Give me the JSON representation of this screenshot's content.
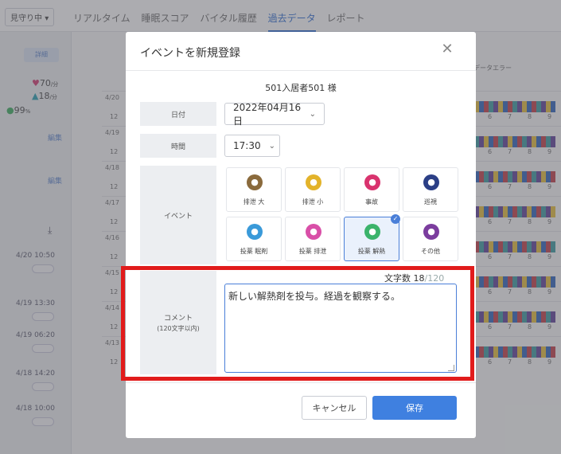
{
  "nav": {
    "watch_label": "見守り中",
    "tabs": [
      {
        "label": "リアルタイム"
      },
      {
        "label": "睡眠スコア"
      },
      {
        "label": "バイタル履歴"
      },
      {
        "label": "過去データ"
      },
      {
        "label": "レポート"
      }
    ],
    "active_tab": "過去データ"
  },
  "sidebar": {
    "detail_button": "詳細",
    "heart_rate": "70",
    "heart_unit": "/分",
    "breath_rate": "18",
    "breath_unit": "/分",
    "spo2": "99",
    "spo2_unit": "%",
    "edit_label_1": "編集",
    "edit_label_2": "編集",
    "entries": [
      {
        "time": "4/20 10:50"
      },
      {
        "time": "4/19 13:30"
      },
      {
        "time": "4/19 06:20"
      },
      {
        "time": "4/18 14:20"
      },
      {
        "time": "4/18 10:00"
      }
    ]
  },
  "chart": {
    "dates": [
      "4/20",
      "4/19",
      "4/18",
      "4/17",
      "4/16",
      "4/15",
      "4/14",
      "4/13"
    ],
    "hour_ticks": [
      "5",
      "6",
      "7",
      "8",
      "9"
    ],
    "row_start_tick": "12",
    "data_error_label": "データエラー",
    "colors": {
      "purple": "#6b4fa0",
      "yellow": "#e8c34a",
      "blue": "#3d6fc2",
      "red": "#c64b55",
      "teal": "#4aa3a8"
    }
  },
  "modal": {
    "title": "イベントを新規登録",
    "close_icon": "close-icon",
    "resident": "501入居者501 様",
    "date_label": "日付",
    "date_value": "2022年04月16日",
    "time_label": "時間",
    "time_value": "17:30",
    "event_label": "イベント",
    "events": [
      {
        "label": "排泄 大",
        "icon": "toilet-large-icon",
        "color": "#8a6a3c",
        "selected": false
      },
      {
        "label": "排泄 小",
        "icon": "toilet-small-icon",
        "color": "#e3b32a",
        "selected": false
      },
      {
        "label": "事故",
        "icon": "accident-icon",
        "color": "#d9336e",
        "selected": false
      },
      {
        "label": "巡視",
        "icon": "patrol-icon",
        "color": "#2b3f86",
        "selected": false
      },
      {
        "label": "投薬 眠剤",
        "icon": "medication-sleep-icon",
        "color": "#3a9ad9",
        "selected": false
      },
      {
        "label": "投薬 排泄",
        "icon": "medication-excretion-icon",
        "color": "#d94fa8",
        "selected": false
      },
      {
        "label": "投薬 解熱",
        "icon": "medication-fever-icon",
        "color": "#3bb36b",
        "selected": true
      },
      {
        "label": "その他",
        "icon": "other-icon",
        "color": "#7b3d9e",
        "selected": false
      }
    ],
    "comment_label": "コメント",
    "comment_sublabel": "(120文字以内)",
    "counter_label": "文字数",
    "counter_current": "18",
    "counter_max": "/120",
    "comment_value": "新しい解熱剤を投与。経過を観察する。",
    "cancel_label": "キャンセル",
    "save_label": "保存"
  }
}
